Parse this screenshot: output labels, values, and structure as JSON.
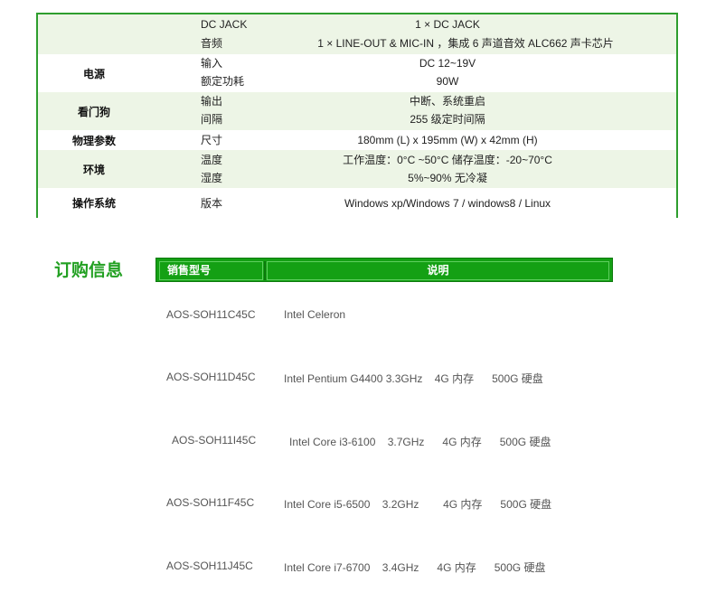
{
  "spec": {
    "rows": [
      {
        "label": "DC JACK",
        "value": "1 × DC JACK"
      },
      {
        "label": "音频",
        "value": "1 × LINE-OUT &   MIC-IN ，集成 6 声道音效 ALC662 声卡芯片"
      },
      {
        "label": "输入",
        "value": "DC   12~19V"
      },
      {
        "label": "额定功耗",
        "value": "90W"
      },
      {
        "label": "输出",
        "value": "中断、系统重启"
      },
      {
        "label": "间隔",
        "value": "255 级定时间隔"
      },
      {
        "label": "尺寸",
        "value": "180mm (L) x 195mm (W) x 42mm (H)"
      },
      {
        "label": "温度",
        "value": "工作温度：0°C ~50°C    储存温度：-20~70°C"
      },
      {
        "label": "湿度",
        "value": "5%~90%  无冷凝"
      },
      {
        "label": "版本",
        "value": "Windows xp/Windows 7 / windows8 / Linux"
      }
    ],
    "groups": {
      "power": "电源",
      "watchdog": "看门狗",
      "physical": "物理参数",
      "environment": "环境",
      "os": "操作系统"
    }
  },
  "order": {
    "title": "订购信息",
    "col_model": "销售型号",
    "col_desc": "说明",
    "items": [
      {
        "model": "AOS-SOH11C45C",
        "desc": "Intel Celeron"
      },
      {
        "model": "AOS-SOH11D45C",
        "desc": "Intel Pentium G4400 3.3GHz    4G 内存      500G 硬盘"
      },
      {
        "model": "AOS-SOH11I45C",
        "desc": "Intel Core i3-6100    3.7GHz      4G 内存      500G 硬盘"
      },
      {
        "model": "AOS-SOH11F45C",
        "desc": "Intel Core i5-6500    3.2GHz        4G 内存      500G 硬盘"
      },
      {
        "model": "AOS-SOH11J45C",
        "desc": "Intel Core i7-6700    3.4GHz      4G 内存      500G 硬盘"
      }
    ]
  }
}
